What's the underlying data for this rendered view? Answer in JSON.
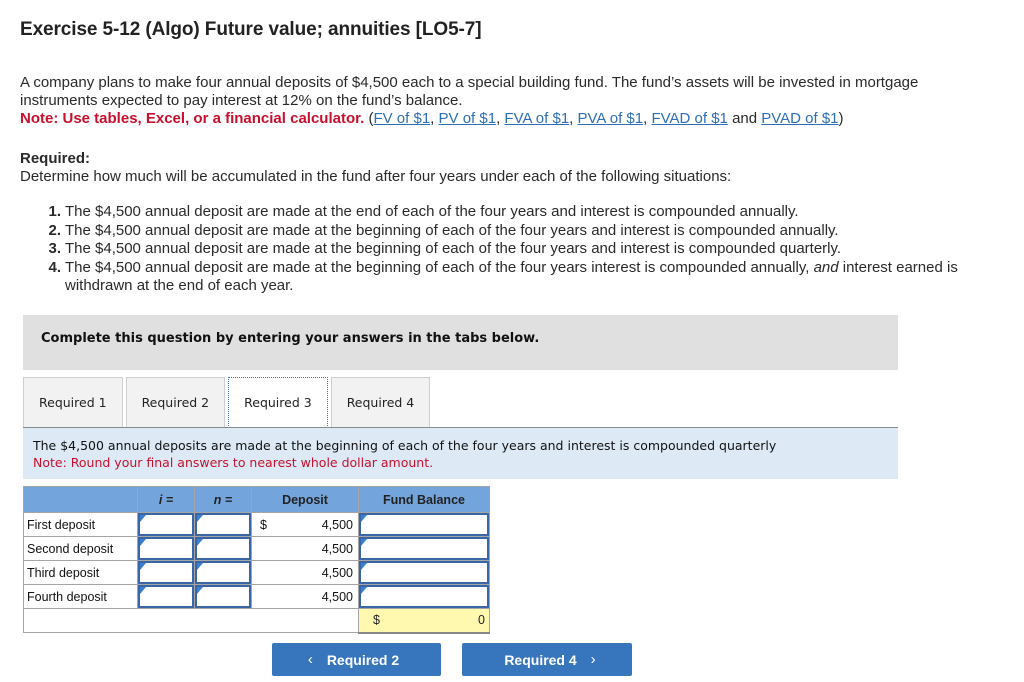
{
  "title": "Exercise 5-12 (Algo) Future value; annuities [LO5-7]",
  "intro": {
    "text": "A company plans to make four annual deposits of $4,500 each to a special building fund. The fund’s assets will be invested in mortgage instruments expected to pay interest at 12% on the fund’s balance.",
    "note": "Note: Use tables, Excel, or a financial calculator.",
    "links": [
      "FV of $1",
      "PV of $1",
      "FVA of $1",
      "PVA of $1",
      "FVAD of $1",
      "PVAD of $1"
    ],
    "and_text": "and"
  },
  "required": {
    "heading": "Required:",
    "description": "Determine how much will be accumulated in the fund after four years under each of the following situations:",
    "items": [
      {
        "num": "1.",
        "text": "The $4,500 annual deposit are made at the end of each of the four years  and interest is compounded annually."
      },
      {
        "num": "2.",
        "text": "The $4,500 annual deposit are made at the beginning of each of the four years and interest is compounded annually."
      },
      {
        "num": "3.",
        "text": "The $4,500 annual deposit are made at the beginning of each of the four years and interest is compounded quarterly."
      },
      {
        "num": "4.",
        "text_before": "The $4,500 annual deposit are made at the beginning of each of the four years interest is compounded annually, ",
        "text_italic": "and",
        "text_after": " interest earned is withdrawn at the end of each year."
      }
    ]
  },
  "complete_panel": "Complete this question by entering your answers in the tabs below.",
  "tabs": [
    {
      "label": "Required 1",
      "active": false
    },
    {
      "label": "Required 2",
      "active": false
    },
    {
      "label": "Required 3",
      "active": true
    },
    {
      "label": "Required 4",
      "active": false
    }
  ],
  "instruction": {
    "text": "The $4,500 annual deposits are made at the beginning of each of the four years and interest is compounded quarterly",
    "note": "Note: Round your final answers to nearest whole dollar amount."
  },
  "table": {
    "headers": [
      "",
      "i =",
      "n =",
      "Deposit",
      "Fund Balance"
    ],
    "currency": "$",
    "rows": [
      {
        "label": "First deposit",
        "i": "",
        "n": "",
        "deposit": "4,500",
        "balance": ""
      },
      {
        "label": "Second deposit",
        "i": "",
        "n": "",
        "deposit": "4,500",
        "balance": ""
      },
      {
        "label": "Third deposit",
        "i": "",
        "n": "",
        "deposit": "4,500",
        "balance": ""
      },
      {
        "label": "Fourth deposit",
        "i": "",
        "n": "",
        "deposit": "4,500",
        "balance": ""
      }
    ],
    "total": "0"
  },
  "nav": {
    "prev_label": "Required 2",
    "next_label": "Required 4",
    "prev_icon": "‹",
    "next_icon": "›"
  },
  "colors": {
    "note_red": "#c8102e",
    "link_blue": "#2d6fb6",
    "header_blue": "#73a5dc",
    "button_blue": "#3776bc",
    "total_yellow": "#fff9b0",
    "instruction_bg": "#ddeaf6"
  }
}
